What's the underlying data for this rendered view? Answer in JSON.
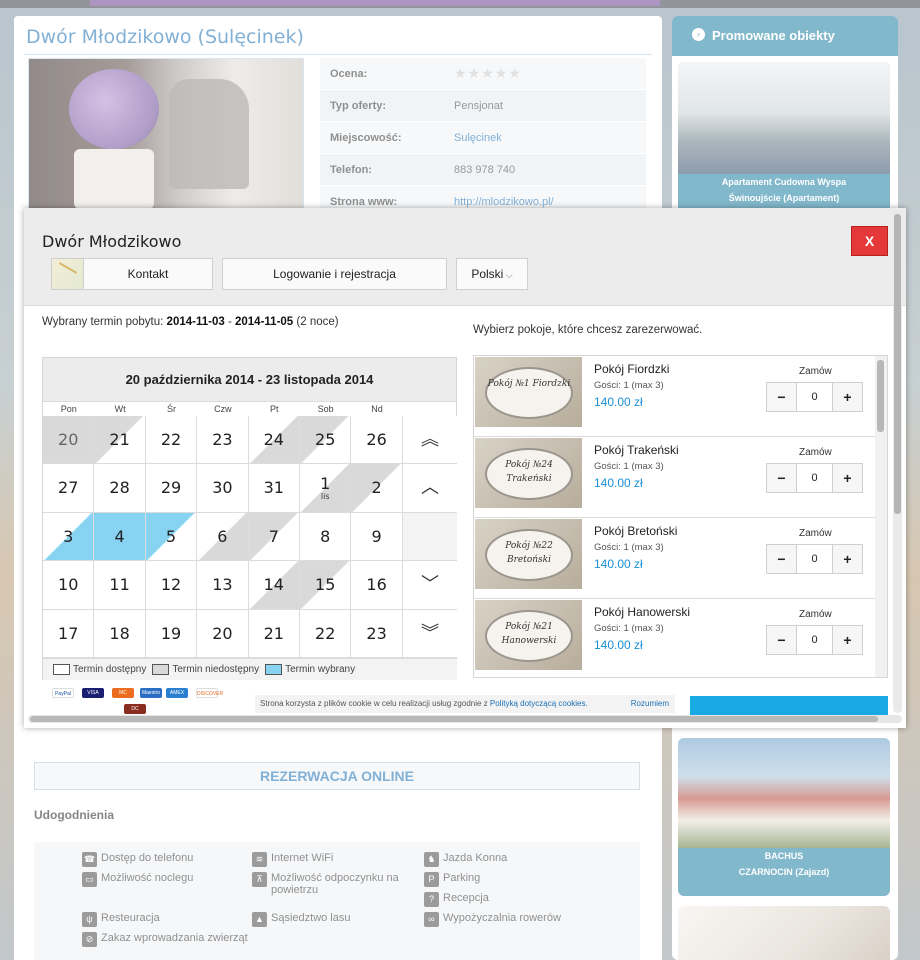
{
  "background": {
    "listing_title": "Dwór Młodzikowo (Sulęcinek)",
    "info": [
      {
        "label": "Ocena:",
        "value": "★★★★★"
      },
      {
        "label": "Typ oferty:",
        "value": "Pensjonat"
      },
      {
        "label": "Miejscowość:",
        "value": "Sulęcinek"
      },
      {
        "label": "Telefon:",
        "value": "883 978 740"
      },
      {
        "label": "Strona www:",
        "value": "http://mlodzikowo.pl/"
      }
    ],
    "reservation_bar": "REZERWACJA ONLINE",
    "amenities_title": "Udogodnienia",
    "amenities": [
      {
        "label": "Dostęp do telefonu",
        "icon": "phone-icon"
      },
      {
        "label": "Internet WiFi",
        "icon": "wifi-icon"
      },
      {
        "label": "Jazda Konna",
        "icon": "horse-icon"
      },
      {
        "label": "Możliwość noclegu",
        "icon": "bed-icon"
      },
      {
        "label": "Możliwość odpoczynku na powietrzu",
        "icon": "picnic-icon"
      },
      {
        "label": "Parking",
        "icon": "parking-icon"
      },
      {
        "label": "Recepcja",
        "icon": "reception-icon"
      },
      {
        "label": "Resteuracja",
        "icon": "restaurant-icon"
      },
      {
        "label": "Sąsiedztwo lasu",
        "icon": "forest-icon"
      },
      {
        "label": "Wypożyczalnia rowerów",
        "icon": "bike-icon"
      },
      {
        "label": "Zakaz wprowadzania zwierząt",
        "icon": "no-pets-icon"
      }
    ],
    "sidebar_title": "Promowane obiekty",
    "promos": [
      {
        "caption_1": "Apartament Cudowna Wyspa",
        "caption_2": "Świnoujście (Apartament)"
      },
      {
        "caption_1": "BACHUS",
        "caption_2": "CZARNOCIN (Zajazd)"
      }
    ]
  },
  "modal": {
    "title": "Dwór Młodzikowo",
    "close_label": "X",
    "tabs": {
      "contact": "Kontakt",
      "login": "Logowanie i rejestracja",
      "language": "Polski"
    },
    "stay": {
      "prefix": "Wybrany termin pobytu:",
      "from": "2014-11-03",
      "sep": "-",
      "to": "2014-11-05",
      "nights": "(2 noce)"
    },
    "rooms_intro": "Wybierz pokoje, które chcesz zarezerwować.",
    "calendar": {
      "range": "20 października 2014 - 23 listopada 2014",
      "dows": [
        "Pon",
        "Wt",
        "Śr",
        "Czw",
        "Pt",
        "Sob",
        "Nd"
      ],
      "weeks": [
        [
          {
            "d": "20",
            "s": "na"
          },
          {
            "d": "21",
            "s": "na-half"
          },
          {
            "d": "22",
            "s": "free"
          },
          {
            "d": "23",
            "s": "free"
          },
          {
            "d": "24",
            "s": "half-na"
          },
          {
            "d": "25",
            "s": "na-half"
          },
          {
            "d": "26",
            "s": "free"
          }
        ],
        [
          {
            "d": "27",
            "s": "free"
          },
          {
            "d": "28",
            "s": "free"
          },
          {
            "d": "29",
            "s": "free"
          },
          {
            "d": "30",
            "s": "free"
          },
          {
            "d": "31",
            "s": "free"
          },
          {
            "d": "1",
            "s": "half-na",
            "sub": "lis"
          },
          {
            "d": "2",
            "s": "na-half"
          }
        ],
        [
          {
            "d": "3",
            "s": "sel-start"
          },
          {
            "d": "4",
            "s": "sel"
          },
          {
            "d": "5",
            "s": "sel-end"
          },
          {
            "d": "6",
            "s": "half-na"
          },
          {
            "d": "7",
            "s": "na-half"
          },
          {
            "d": "8",
            "s": "free"
          },
          {
            "d": "9",
            "s": "free"
          }
        ],
        [
          {
            "d": "10",
            "s": "free"
          },
          {
            "d": "11",
            "s": "free"
          },
          {
            "d": "12",
            "s": "free"
          },
          {
            "d": "13",
            "s": "free"
          },
          {
            "d": "14",
            "s": "half-na"
          },
          {
            "d": "15",
            "s": "na-half"
          },
          {
            "d": "16",
            "s": "free"
          }
        ],
        [
          {
            "d": "17",
            "s": "free"
          },
          {
            "d": "18",
            "s": "free"
          },
          {
            "d": "19",
            "s": "free"
          },
          {
            "d": "20",
            "s": "free"
          },
          {
            "d": "21",
            "s": "free"
          },
          {
            "d": "22",
            "s": "free"
          },
          {
            "d": "23",
            "s": "free"
          }
        ]
      ],
      "legend": {
        "free": "Termin dostępny",
        "na": "Termin niedostępny",
        "sel": "Termin wybrany"
      },
      "colors": {
        "free": "#ffffff",
        "na": "#d9d9d9",
        "sel": "#89d3f2"
      }
    },
    "rooms": [
      {
        "name": "Pokój Fiordzki",
        "guests": "Gości: 1 (max 3)",
        "price": "140.00 zł",
        "order_label": "Zamów",
        "qty": "0",
        "plate": "Pokój №1 Fiordzki"
      },
      {
        "name": "Pokój Trakeński",
        "guests": "Gości: 1 (max 3)",
        "price": "140.00 zł",
        "order_label": "Zamów",
        "qty": "0",
        "plate": "Pokój №24 Trakeński"
      },
      {
        "name": "Pokój Bretoński",
        "guests": "Gości: 1 (max 3)",
        "price": "140.00 zł",
        "order_label": "Zamów",
        "qty": "0",
        "plate": "Pokój №22 Bretoński"
      },
      {
        "name": "Pokój Hanowerski",
        "guests": "Gości: 1 (max 3)",
        "price": "140.00 zł",
        "order_label": "Zamów",
        "qty": "0",
        "plate": "Pokój №21 Hanowerski"
      }
    ],
    "payments": [
      "PayPal",
      "VISA",
      "MC",
      "Maestro",
      "AMEX",
      "DISCOVER",
      "DC"
    ],
    "cookie": {
      "text": "Strona korzysta z plików cookie w celu realizacji usług zgodnie z",
      "link": "Polityką dotyczącą cookies.",
      "ok": "Rozumiem"
    },
    "accent_color": "#19a9e3",
    "close_color": "#e53939"
  }
}
